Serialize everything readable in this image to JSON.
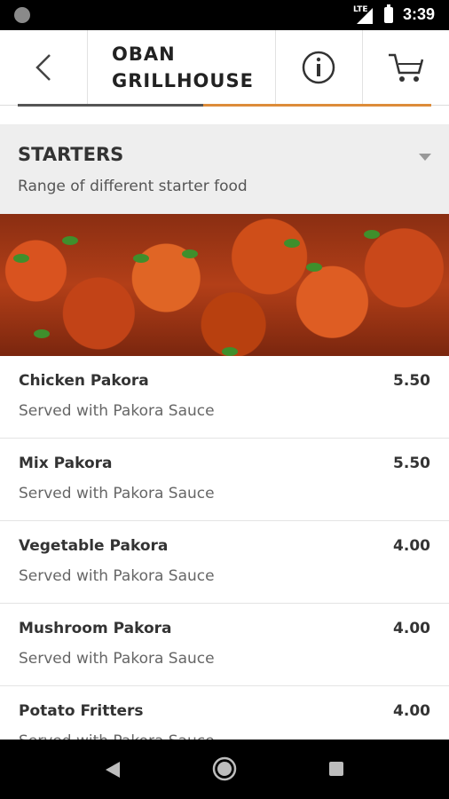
{
  "status_bar": {
    "network": "LTE",
    "time": "3:39"
  },
  "restaurant": {
    "name_line1": "OBAN",
    "name_line2": "GRILLHOUSE"
  },
  "section": {
    "title": "STARTERS",
    "subtitle": "Range of different starter food"
  },
  "menu_items": [
    {
      "name": "Chicken Pakora",
      "price": "5.50",
      "description": "Served with Pakora Sauce"
    },
    {
      "name": "Mix Pakora",
      "price": "5.50",
      "description": "Served with Pakora Sauce"
    },
    {
      "name": "Vegetable Pakora",
      "price": "4.00",
      "description": "Served with Pakora Sauce"
    },
    {
      "name": "Mushroom Pakora",
      "price": "4.00",
      "description": "Served with Pakora Sauce"
    },
    {
      "name": "Potato Fritters",
      "price": "4.00",
      "description": "Served with Pakora Sauce"
    }
  ],
  "icons": {
    "back": "chevron-left-icon",
    "info": "info-circle-icon",
    "cart": "shopping-cart-icon",
    "collapse": "caret-down-icon"
  },
  "colors": {
    "accent": "#dd8c3a",
    "section_bg": "#eeeeee",
    "text": "#333333"
  }
}
